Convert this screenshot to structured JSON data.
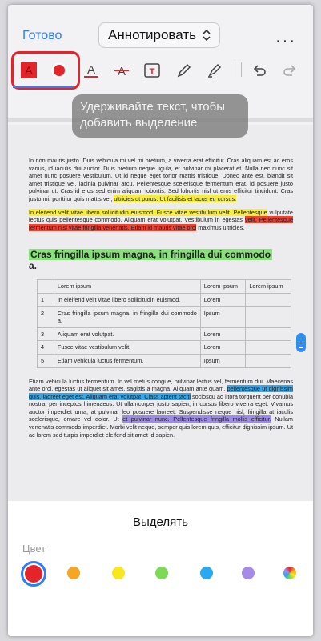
{
  "header": {
    "done_label": "Готово",
    "mode_label": "Аннотировать",
    "more_label": "···"
  },
  "toolbar": {
    "tools": [
      {
        "name": "highlight-tool",
        "glyph": "A",
        "color": "#e3242b"
      },
      {
        "name": "color-picker",
        "color": "#e3242b"
      },
      {
        "name": "underline-tool",
        "glyph": "A",
        "color": "#e3242b"
      },
      {
        "name": "strikethrough-tool",
        "glyph": "A"
      },
      {
        "name": "textbox-tool",
        "glyph": "T",
        "color": "#e3242b"
      },
      {
        "name": "pen-tool",
        "glyph": "✎"
      },
      {
        "name": "marker-tool",
        "glyph": "✐"
      },
      {
        "name": "undo",
        "glyph": "↶"
      },
      {
        "name": "redo",
        "glyph": "↷"
      }
    ]
  },
  "hint": "Удерживайте текст, чтобы добавить выделение",
  "document": {
    "para1_normal": "In non mauris justo. Duis vehicula mi vel mi pretium, a viverra erat efficitur. Cras aliquam est ac eros varius, id iaculis dui auctor. Duis pretium neque ligula, et pulvinar mi placerat et. Nulla nec nunc sit amet nunc posuere vestibulum. Ut id neque eget tortor mattis tristique. Donec ante est, blandit sit amet tristique vel, lacinia pulvinar arcu. Pellentesque scelerisque fermentum erat, id posuere justo pulvinar ut. Cras id eros sed enim aliquam lobortis. Sed lobortis nisl ut eros efficitur tincidunt. Cras justo mi, porttitor quis mattis vel, ",
    "para1_yellow": "ultricies ut purus. Ut facilisis et lacus eu cursus.",
    "para2_yellow": "In eleifend velit vitae libero sollicitudin euismod. Fusce vitae vestibulum velit. Pellentesque",
    "para2_normal": " vulputate lectus quis pellentesque commodo. Aliquam erat volutpat. Vestibulum in egestas ",
    "para2_red": "velit. Pellentesque fermentum nisl vitae fringilla venenatis. Etiam id mauris vitae orci",
    "para2_tail": " maximus ultricies.",
    "heading_green": "Cras fringilla ipsum magna, in fringilla dui commodo",
    "heading_tail": "a.",
    "table": [
      [
        "",
        "Lorem ipsum",
        "Lorem ipsum",
        "Lorem ipsum"
      ],
      [
        "1",
        "In eleifend velit vitae libero sollicitudin euismod.",
        "Lorem",
        ""
      ],
      [
        "2",
        "Cras fringilla ipsum magna, in fringilla dui commodo a.",
        "Ipsum",
        ""
      ],
      [
        "3",
        "Aliquam erat volutpat.",
        "Lorem",
        ""
      ],
      [
        "4",
        "Fusce vitae vestibulum velit.",
        "Lorem",
        ""
      ],
      [
        "5",
        "Etiam vehicula luctus fermentum.",
        "Ipsum",
        ""
      ]
    ],
    "para3_a": "Etiam vehicula luctus fermentum. In vel metus congue, pulvinar lectus vel, fermentum dui. Maecenas ante orci, egestas ut aliquet sit amet, sagittis a magna. Aliquam ante quam, ",
    "para3_blue": "pellentesque ut dignissim quis, laoreet eget est. Aliquam erat volutpat. Class aptent taciti",
    "para3_b": " sociosqu ad litora torquent per conubia nostra, per inceptos himenaeos. Ut ullamcorper justo sapien, in cursus libero viverra eget. Vivamus auctor imperdiet urna, at pulvinar leo posuere laoreet. Suspendisse neque nisl, fringilla at iaculis scelerisque, ornare vel dolor. Ut ",
    "para3_purple": "et pulvinar nunc. Pellentesque fringilla mollis efficitur.",
    "para3_c": " Nullam venenatis commodo imperdiet. Morbi velit neque, semper quis lorem quis, efficitur dignissim ipsum. Ut ac lorem sed turpis imperdiet eleifend sit amet id sapien."
  },
  "sheet": {
    "title": "Выделять",
    "color_label": "Цвет",
    "colors": [
      {
        "name": "red",
        "hex": "#e3242b",
        "selected": true
      },
      {
        "name": "orange",
        "hex": "#f5a623"
      },
      {
        "name": "yellow",
        "hex": "#f8e71c"
      },
      {
        "name": "green",
        "hex": "#7ed957"
      },
      {
        "name": "blue",
        "hex": "#2aa8f0"
      },
      {
        "name": "purple",
        "hex": "#a78be8"
      },
      {
        "name": "multicolor",
        "hex": "conic"
      }
    ]
  }
}
